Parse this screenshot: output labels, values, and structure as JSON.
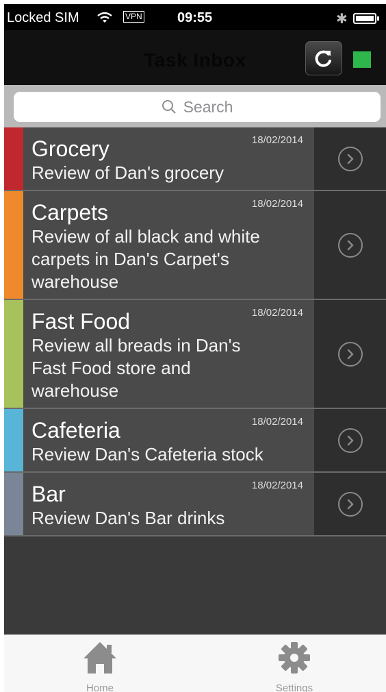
{
  "status_bar": {
    "carrier": "Locked SIM",
    "vpn": "VPN",
    "time": "09:55",
    "bluetooth": "✱"
  },
  "nav": {
    "title": "Task Inbox",
    "refresh_icon": "refresh-icon",
    "indicator_color": "#2eb84c"
  },
  "search": {
    "placeholder": "Search"
  },
  "tasks": [
    {
      "title": "Grocery",
      "date": "18/02/2014",
      "desc_lines": [
        "Review of Dan's grocery"
      ],
      "color": "#c0282e"
    },
    {
      "title": "Carpets",
      "date": "18/02/2014",
      "desc_lines": [
        "Review of all black and white",
        "carpets in Dan's Carpet's",
        "warehouse"
      ],
      "color": "#ee8a2b"
    },
    {
      "title": "Fast Food",
      "date": "18/02/2014",
      "desc_lines": [
        "Review all breads in Dan's",
        "Fast Food store and",
        "warehouse"
      ],
      "color": "#a7c25c"
    },
    {
      "title": "Cafeteria",
      "date": "18/02/2014",
      "desc_lines": [
        "Review Dan's Cafeteria stock"
      ],
      "color": "#58b5d7"
    },
    {
      "title": "Bar",
      "date": "18/02/2014",
      "desc_lines": [
        "Review Dan's Bar drinks"
      ],
      "color": "#7a8597"
    }
  ],
  "tab_bar": {
    "home_label": "Home",
    "settings_label": "Settings",
    "home_icon": "home-icon",
    "settings_icon": "gear-icon"
  }
}
